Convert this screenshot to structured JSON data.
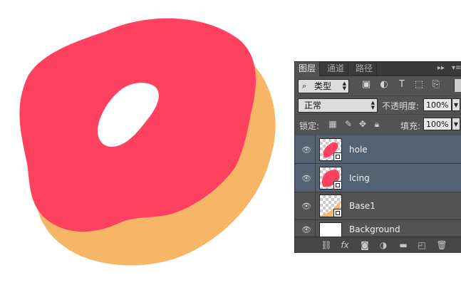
{
  "colors": {
    "icing": "#ff4160",
    "base": "#f7b666",
    "panel_bg": "#535353",
    "selected_layer": "#556274"
  },
  "panel": {
    "tabs": [
      {
        "label": "图层",
        "active": true
      },
      {
        "label": "通道",
        "active": false
      },
      {
        "label": "路径",
        "active": false
      }
    ],
    "menu_icons": [
      "expand-arrows-icon",
      "panel-menu-icon"
    ]
  },
  "filter": {
    "kind_label": "类型",
    "icons": [
      "image-filter-icon",
      "adjustment-filter-icon",
      "type-filter-icon",
      "shape-filter-icon",
      "smart-object-filter-icon"
    ]
  },
  "blend": {
    "mode": "正常",
    "opacity_label": "不透明度:",
    "opacity_value": "100%"
  },
  "lock": {
    "label": "锁定:",
    "icons": [
      "lock-transparent-icon",
      "lock-paint-icon",
      "lock-move-icon",
      "lock-all-icon"
    ],
    "fill_label": "填充:",
    "fill_value": "100%"
  },
  "layers": [
    {
      "name": "hole",
      "selected": true,
      "thumb": "shape-red"
    },
    {
      "name": "Icing",
      "selected": true,
      "thumb": "shape-red"
    },
    {
      "name": "Base1",
      "selected": false,
      "thumb": "shape-orange"
    },
    {
      "name": "Background",
      "selected": false,
      "thumb": "white"
    }
  ],
  "bottom_icons": [
    "link-layers-icon",
    "fx-icon",
    "add-mask-icon",
    "adjustment-layer-icon",
    "new-group-icon",
    "new-layer-icon",
    "trash-icon"
  ]
}
